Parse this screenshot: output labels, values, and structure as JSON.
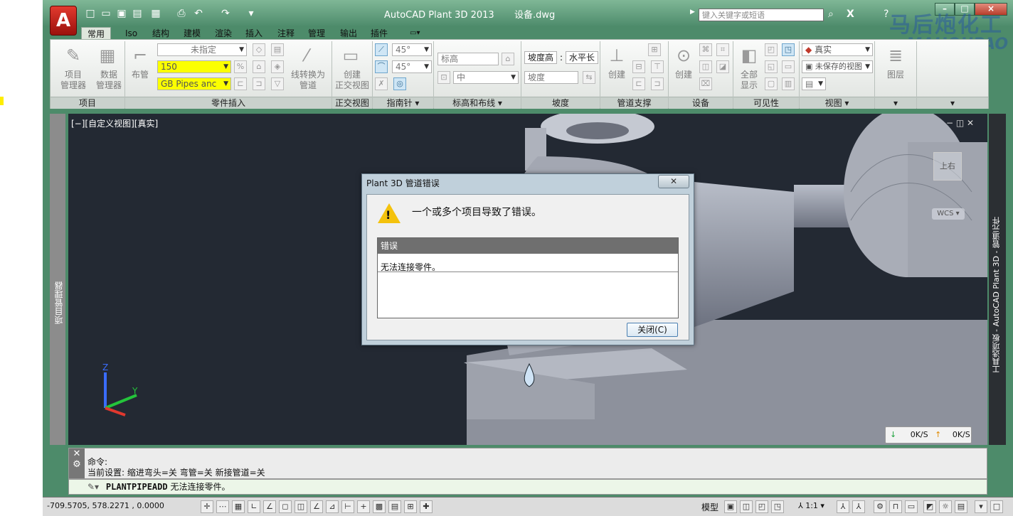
{
  "window": {
    "title": "AutoCAD Plant 3D 2013",
    "filename": "设备.dwg",
    "search_placeholder": "键入关键字或短语",
    "app_logo": "A"
  },
  "ribbon_tabs": [
    "常用",
    "Iso",
    "结构",
    "建模",
    "渲染",
    "插入",
    "注释",
    "管理",
    "输出",
    "插件"
  ],
  "ribbon": {
    "project": {
      "btn1": "项目",
      "btn1b": "管理器",
      "btn2": "数据",
      "btn2b": "管理器",
      "title": "项目"
    },
    "part_insert": {
      "spec_value": "未指定",
      "size_value": "150",
      "spec_sheet_value": "GB Pipes anc",
      "route_btn": "布管",
      "convert_btn1": "线转换为",
      "convert_btn2": "管道",
      "title": "零件插入"
    },
    "ortho": {
      "btn1": "创建",
      "btn2": "正交视图",
      "title": "正交视图"
    },
    "compass": {
      "angle1": "45°",
      "angle2": "45°",
      "title": "指南针"
    },
    "elevation": {
      "field1": "标高",
      "field2": "中",
      "title": "标高和布线"
    },
    "slope": {
      "btn1": "坡度高",
      "btn2": "水平长",
      "field": "坡度",
      "title": "坡度"
    },
    "support": {
      "btn": "创建",
      "title": "管道支撑"
    },
    "equipment": {
      "btn": "创建",
      "title": "设备"
    },
    "visibility": {
      "btn1": "全部",
      "btn2": "显示",
      "title": "可见性"
    },
    "views": {
      "visual_style": "真实",
      "saved_view": "未保存的视图",
      "title": "视图"
    },
    "layers": {
      "btn": "图层"
    }
  },
  "viewport": {
    "label": "[−][自定义视图][真实]",
    "left_palette": "项目管理器",
    "right_palette": "工具选项板 - AutoCAD Plant 3D - 管道元件",
    "viewcube_top": "上",
    "viewcube_face": "右",
    "wcs": "WCS",
    "axis_z": "Z",
    "axis_y": "Y",
    "net_down": "0K/S",
    "net_up": "0K/S"
  },
  "dialog": {
    "title": "Plant 3D 管道错误",
    "message": "一个或多个项目导致了错误。",
    "table_header": "错误",
    "table_row": "无法连接零件。",
    "close_button": "关闭(C)"
  },
  "command": {
    "line1": "命令:",
    "line2": "当前设置: 缩进弯头=关  弯管=关  新接管道=关",
    "input_cmd": "PLANTPIPEADD",
    "input_msg": "无法连接零件。"
  },
  "status": {
    "coords": "-709.5705,   578.2271 , 0.0000",
    "model": "模型",
    "scale": "1:1"
  },
  "watermark": {
    "line1": "马后炮化工",
    "line2": "MAHOUPAO"
  }
}
